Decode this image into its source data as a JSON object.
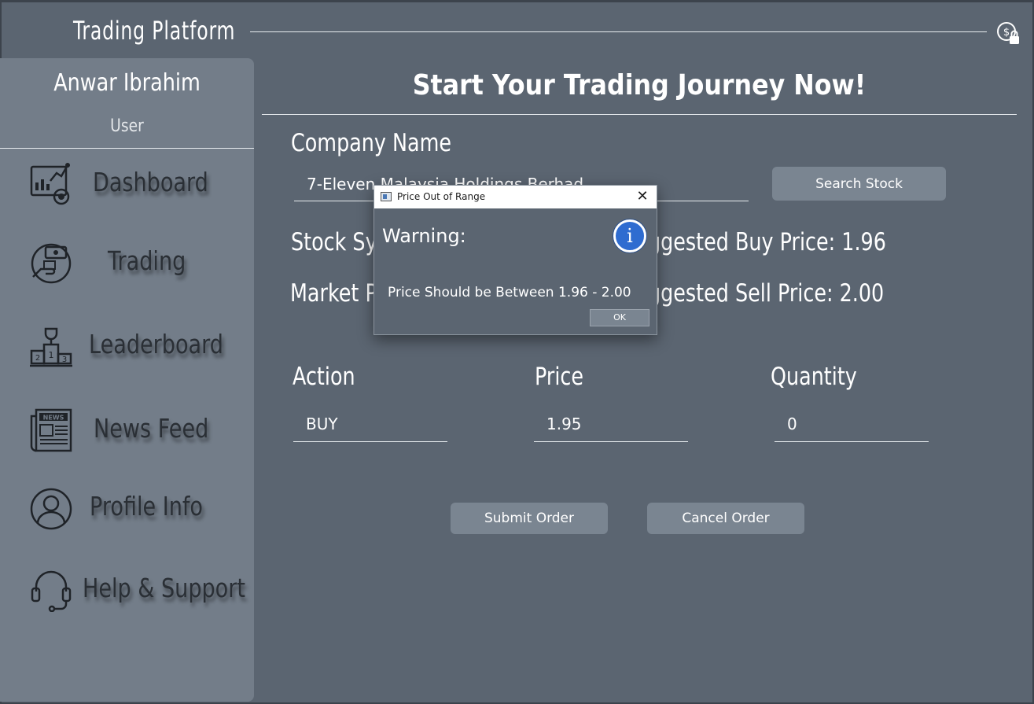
{
  "app": {
    "title": "Trading  Platform",
    "header_icon": "money-lock-icon"
  },
  "sidebar": {
    "user_name": "Anwar Ibrahim",
    "user_role": "User",
    "items": [
      {
        "label": "Dashboard",
        "icon": "dashboard-icon"
      },
      {
        "label": "Trading",
        "icon": "trading-icon"
      },
      {
        "label": "Leaderboard",
        "icon": "leaderboard-icon"
      },
      {
        "label": "News Feed",
        "icon": "news-feed-icon"
      },
      {
        "label": "Profile Info",
        "icon": "profile-icon"
      },
      {
        "label": "Help & Support",
        "icon": "headset-icon"
      }
    ]
  },
  "main": {
    "heading": "Start Your Trading Journey Now!",
    "company_label": "Company Name",
    "company_value": "7-Eleven Malaysia Holdings Berhad",
    "search_button": "Search Stock",
    "stock_symbol_label": "Stock Sym",
    "market_price_label": "Market P",
    "suggested_buy": "ggested Buy Price: 1.96",
    "suggested_sell": "ggested Sell Price: 2.00",
    "action_label": "Action",
    "action_value": "BUY",
    "price_label": "Price",
    "price_value": "1.95",
    "quantity_label": "Quantity",
    "quantity_value": "0",
    "submit_button": "Submit Order",
    "cancel_button": "Cancel Order"
  },
  "dialog": {
    "title": "Price Out of Range",
    "close_glyph": "✕",
    "header": "Warning:",
    "icon": "info-icon",
    "icon_glyph": "i",
    "message": "Price Should be Between 1.96 - 2.00",
    "ok_button": "OK"
  },
  "colors": {
    "background": "#5b6571",
    "sidebar": "#737d89",
    "button": "#7a8591",
    "info_blue": "#2f6cd0"
  }
}
